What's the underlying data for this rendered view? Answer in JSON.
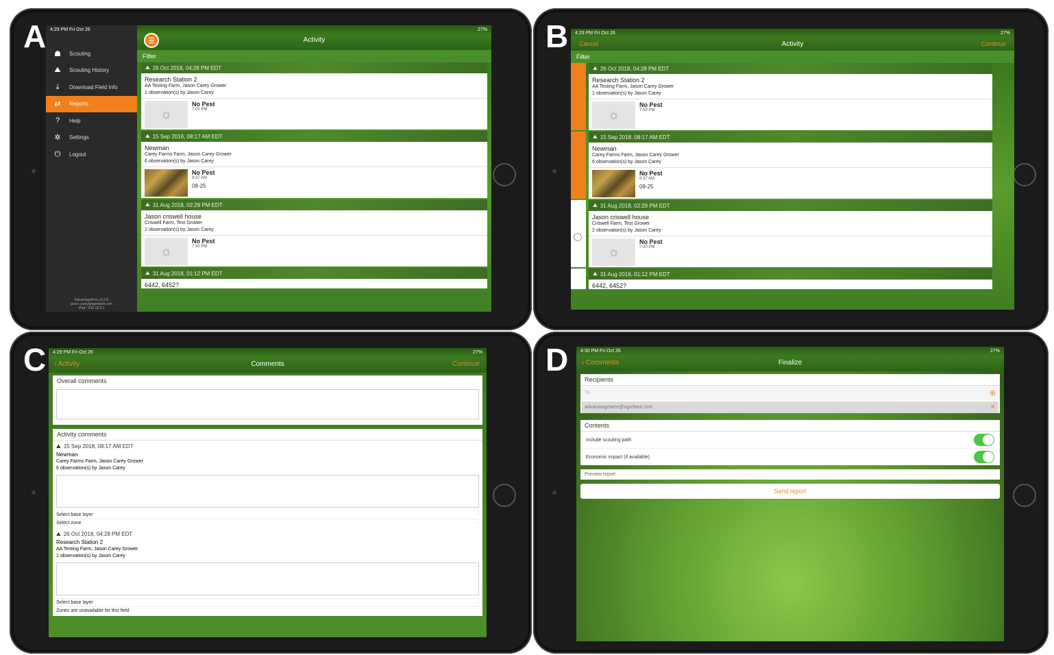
{
  "panels": {
    "a": {
      "letter": "A",
      "status": {
        "time": "4:29 PM  Fri Oct 26",
        "right": "27%"
      },
      "title": "Activity",
      "filter": "Filter",
      "menu": [
        {
          "icon": "scouting-icon",
          "label": "Scouting"
        },
        {
          "icon": "history-icon",
          "label": "Scouting History"
        },
        {
          "icon": "download-icon",
          "label": "Download Field Info"
        },
        {
          "icon": "reports-icon",
          "label": "Reports"
        },
        {
          "icon": "help-icon",
          "label": "Help"
        },
        {
          "icon": "settings-icon",
          "label": "Settings"
        },
        {
          "icon": "logout-icon",
          "label": "Logout"
        }
      ],
      "footer": [
        "AdvantageAcre v3.2.8",
        "jason.carey@agreliant.com",
        "iPad - iOS 12.0.1"
      ]
    },
    "b": {
      "letter": "B",
      "status": {
        "time": "4:29 PM  Fri Oct 26",
        "right": "27%"
      },
      "cancel": "Cancel",
      "title": "Activity",
      "continue": "Continue",
      "filter": "Filter"
    },
    "c": {
      "letter": "C",
      "status": {
        "time": "4:29 PM  Fri Oct 26",
        "right": "27%"
      },
      "back": "Activity",
      "title": "Comments",
      "continue": "Continue",
      "overall": "Overall comments",
      "activity_comments": "Activity comments",
      "entries": [
        {
          "date": "15 Sep 2018, 08:17 AM EDT",
          "title": "Newman",
          "farm": "Carey Farms Farm, Jason Carey Grower",
          "obs": "6 observation(s) by Jason Carey",
          "row1": "Select base layer",
          "row2": "Select zone"
        },
        {
          "date": "26 Oct 2018, 04:28 PM EDT",
          "title": "Research Station 2",
          "farm": "AA Testing Farm, Jason Carey Grower",
          "obs": "1 observation(s) by Jason Carey",
          "row1": "Select base layer",
          "row2": "Zones are unavailable for this field"
        }
      ]
    },
    "d": {
      "letter": "D",
      "status": {
        "time": "4:30 PM  Fri Oct 26",
        "right": "27%"
      },
      "back": "Comments",
      "title": "Finalize",
      "recipients": "Recipients",
      "to": "To:",
      "email": "advanatageacre@agreliant.com",
      "contents": "Contents",
      "opt1": "Include scouting path",
      "opt2": "Economic impact (if available)",
      "preview": "Preview report",
      "send": "Send report"
    }
  },
  "activities": [
    {
      "date": "26 Oct 2018, 04:28 PM EDT",
      "title": "Research Station 2",
      "farm": "AA Testing Farm, Jason Carey Grower",
      "obs": "1 observation(s) by Jason Carey",
      "pest": "No Pest",
      "time": "7:00 PM",
      "extra": "",
      "photo": "placeholder"
    },
    {
      "date": "15 Sep 2018, 08:17 AM EDT",
      "title": "Newman",
      "farm": "Carey Farms Farm, Jason Carey Grower",
      "obs": "6 observation(s) by Jason Carey",
      "pest": "No Pest",
      "time": "8:37 AM",
      "extra": "08-25",
      "photo": "corn"
    },
    {
      "date": "31 Aug 2018, 02:29 PM EDT",
      "title": "Jason criswell house",
      "farm": "Criswell Farm, Test Grower",
      "obs": "2 observation(s) by Jason Carey",
      "pest": "No Pest",
      "time": "7:00 PM",
      "extra": "",
      "photo": "placeholder"
    },
    {
      "date": "31 Aug 2018, 01:12 PM EDT",
      "title": "6442, 6452?"
    }
  ],
  "colors": {
    "accent": "#f07f1c",
    "green": "#3b7a1f",
    "toggle": "#4cc545"
  }
}
